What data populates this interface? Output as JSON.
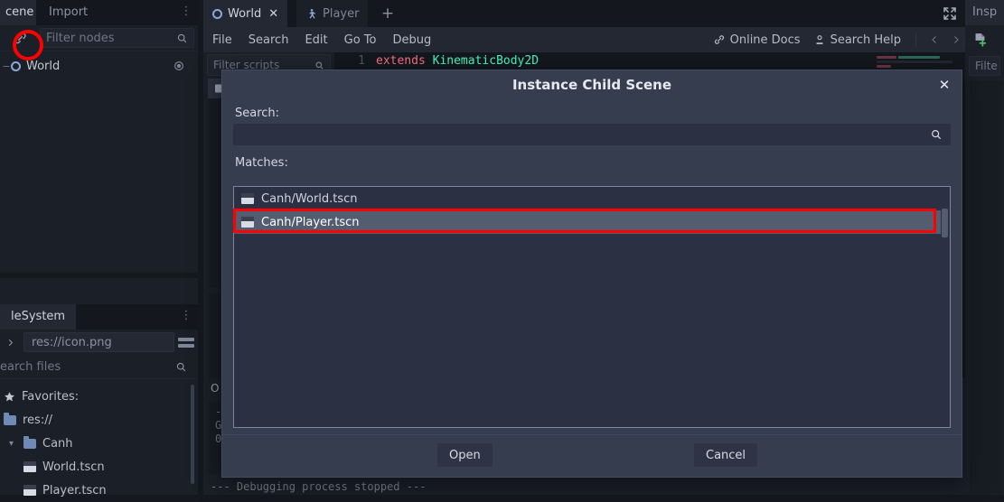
{
  "app": {
    "name": "Godot Engine Editor",
    "theme_bg": "#15181e",
    "dialog_bg": "#363d4f",
    "accent_red": "#ff0000"
  },
  "left_dock": {
    "tabs": [
      {
        "label": "cene",
        "active": true,
        "name": "tab-scene"
      },
      {
        "label": "Import",
        "active": false,
        "name": "tab-import"
      }
    ],
    "menu_dots": "⋮",
    "instance_child_scene_icon": "link-icon",
    "filter_placeholder": "Filter nodes",
    "search_icon": "search-icon",
    "tree": [
      {
        "label": "World",
        "icon": "node2d-icon",
        "visibility_icon": "eye-icon"
      }
    ]
  },
  "filesystem": {
    "tab_label": "leSystem",
    "menu_dots": "⋮",
    "path_value": "res://icon.png",
    "search_placeholder": "earch files",
    "items": [
      {
        "label": "Favorites:",
        "icon": "star-icon",
        "indent": 1
      },
      {
        "label": "res://",
        "icon": "folder-icon",
        "indent": 1
      },
      {
        "label": "Canh",
        "icon": "folder-icon",
        "indent": 2,
        "expanded": true
      },
      {
        "label": "World.tscn",
        "icon": "scene-icon",
        "indent": 3
      },
      {
        "label": "Player.tscn",
        "icon": "scene-icon",
        "indent": 3
      }
    ]
  },
  "center": {
    "scene_tabs": [
      {
        "label": "World",
        "active": true,
        "closable": true,
        "icon": "node2d-icon"
      },
      {
        "label": "Player",
        "active": false,
        "closable": false,
        "icon": "kinematicbody2d-icon"
      }
    ],
    "add_tab_label": "+",
    "expand_icon": "expand-icon",
    "script_menu": [
      "File",
      "Search",
      "Edit",
      "Go To",
      "Debug"
    ],
    "online_docs_label": "Online Docs",
    "online_docs_icon": "link-icon",
    "search_help_label": "Search Help",
    "search_help_icon": "doc-search-icon",
    "nav_prev_icon": "chevron-left-icon",
    "nav_next_icon": "chevron-right-icon",
    "scripts_filter_placeholder": "Filter scripts",
    "scripts_items": [
      {
        "label": "",
        "selected": true,
        "icon": "script-icon"
      }
    ],
    "code_lines": [
      {
        "number": "1",
        "keyword": "extends",
        "rest": "KinematicBody2D"
      }
    ]
  },
  "bottom_panel": {
    "tab_label": "O",
    "lines": [
      "-",
      "G",
      "0"
    ],
    "status_text": "--- Debugging process stopped ---"
  },
  "right_dock": {
    "tab_label": "Insp",
    "new_resource_icon": "new-resource-icon",
    "filter_placeholder": "Filte"
  },
  "dialog": {
    "title": "Instance Child Scene",
    "close_label": "✕",
    "search_label": "Search:",
    "search_value": "",
    "search_icon": "search-icon",
    "matches_label": "Matches:",
    "matches": [
      {
        "label": "Canh/World.tscn",
        "icon": "scene-icon",
        "selected": false
      },
      {
        "label": "Canh/Player.tscn",
        "icon": "scene-icon",
        "selected": true
      }
    ],
    "open_label": "Open",
    "cancel_label": "Cancel"
  },
  "annotations": [
    {
      "type": "circle",
      "target": "instance-child-scene-button"
    },
    {
      "type": "rectangle",
      "target": "dialog-match-player-tscn"
    }
  ]
}
